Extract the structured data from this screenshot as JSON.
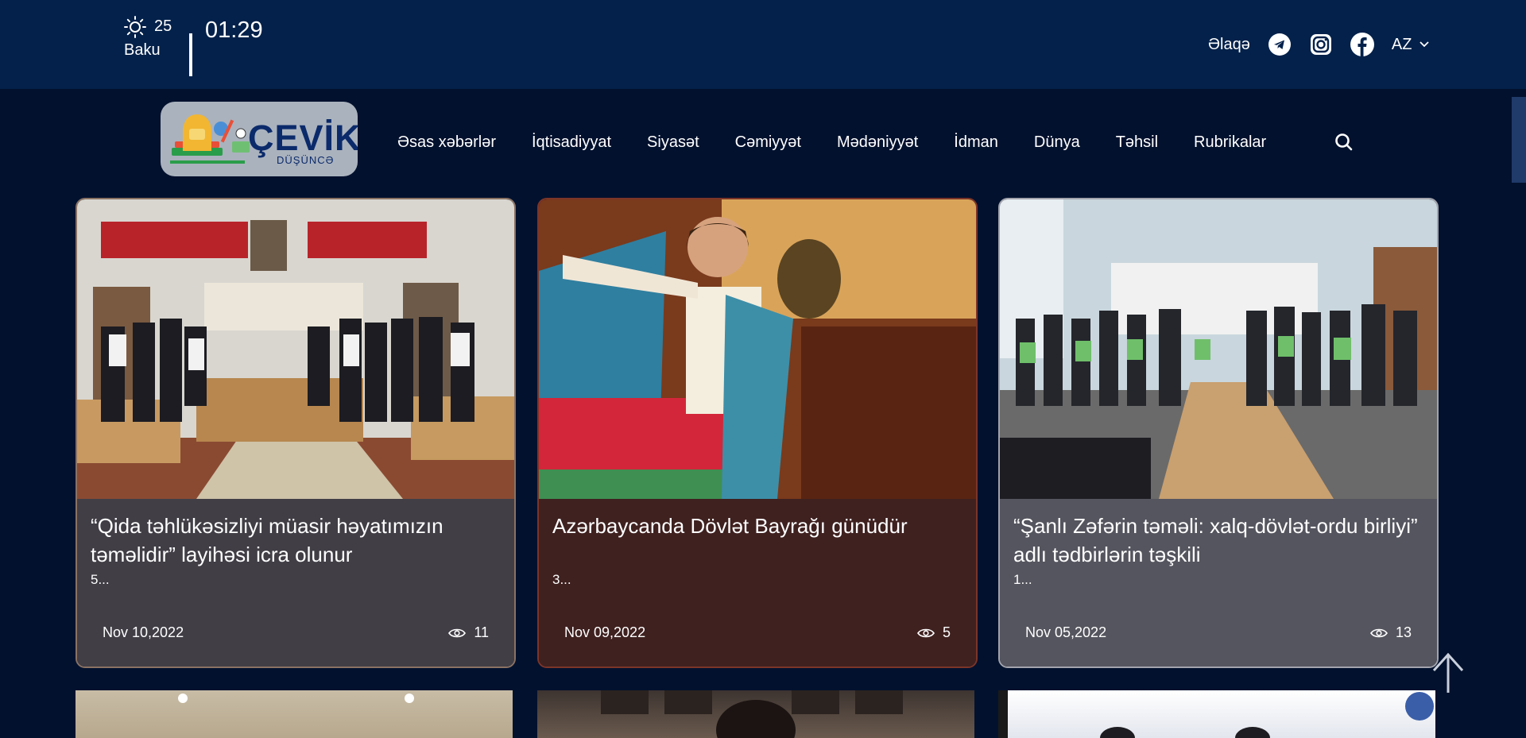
{
  "header": {
    "weather": {
      "temp": "25",
      "city": "Baku",
      "icon": "sun-icon"
    },
    "time": "01:29",
    "contact_label": "Əlaqə",
    "social": [
      "telegram-icon",
      "instagram-icon",
      "facebook-icon"
    ],
    "language": "AZ"
  },
  "logo": {
    "word": "ÇEVİK",
    "subtitle": "DÜŞÜNCƏ"
  },
  "nav": {
    "items": [
      {
        "label": "Əsas xəbərlər"
      },
      {
        "label": "İqtisadiyyat"
      },
      {
        "label": "Siyasət"
      },
      {
        "label": "Cəmiyyət"
      },
      {
        "label": "Mədəniyyət"
      },
      {
        "label": "İdman"
      },
      {
        "label": "Dünya"
      },
      {
        "label": "Təhsil"
      },
      {
        "label": "Rubrikalar"
      }
    ],
    "search_icon": "search-icon"
  },
  "cards": [
    {
      "title": "“Qida təhlükəsizliyi müasir həyatımızın təməlidir” layihəsi icra olunur",
      "excerpt": "5...",
      "date": "Nov 10,2022",
      "views": "11"
    },
    {
      "title": "Azərbaycanda Dövlət Bayrağı günüdür",
      "excerpt": "3...",
      "date": "Nov 09,2022",
      "views": "5"
    },
    {
      "title": "“Şanlı Zəfərin təməli: xalq-dövlət-ordu birliyi” adlı tədbirlərin təşkili",
      "excerpt": "1...",
      "date": "Nov 05,2022",
      "views": "13"
    }
  ],
  "colors": {
    "topbar": "#03214a",
    "page_bg": "#02112e",
    "card1": "#413e46",
    "card2": "#3f2120",
    "card3": "#55555f"
  }
}
